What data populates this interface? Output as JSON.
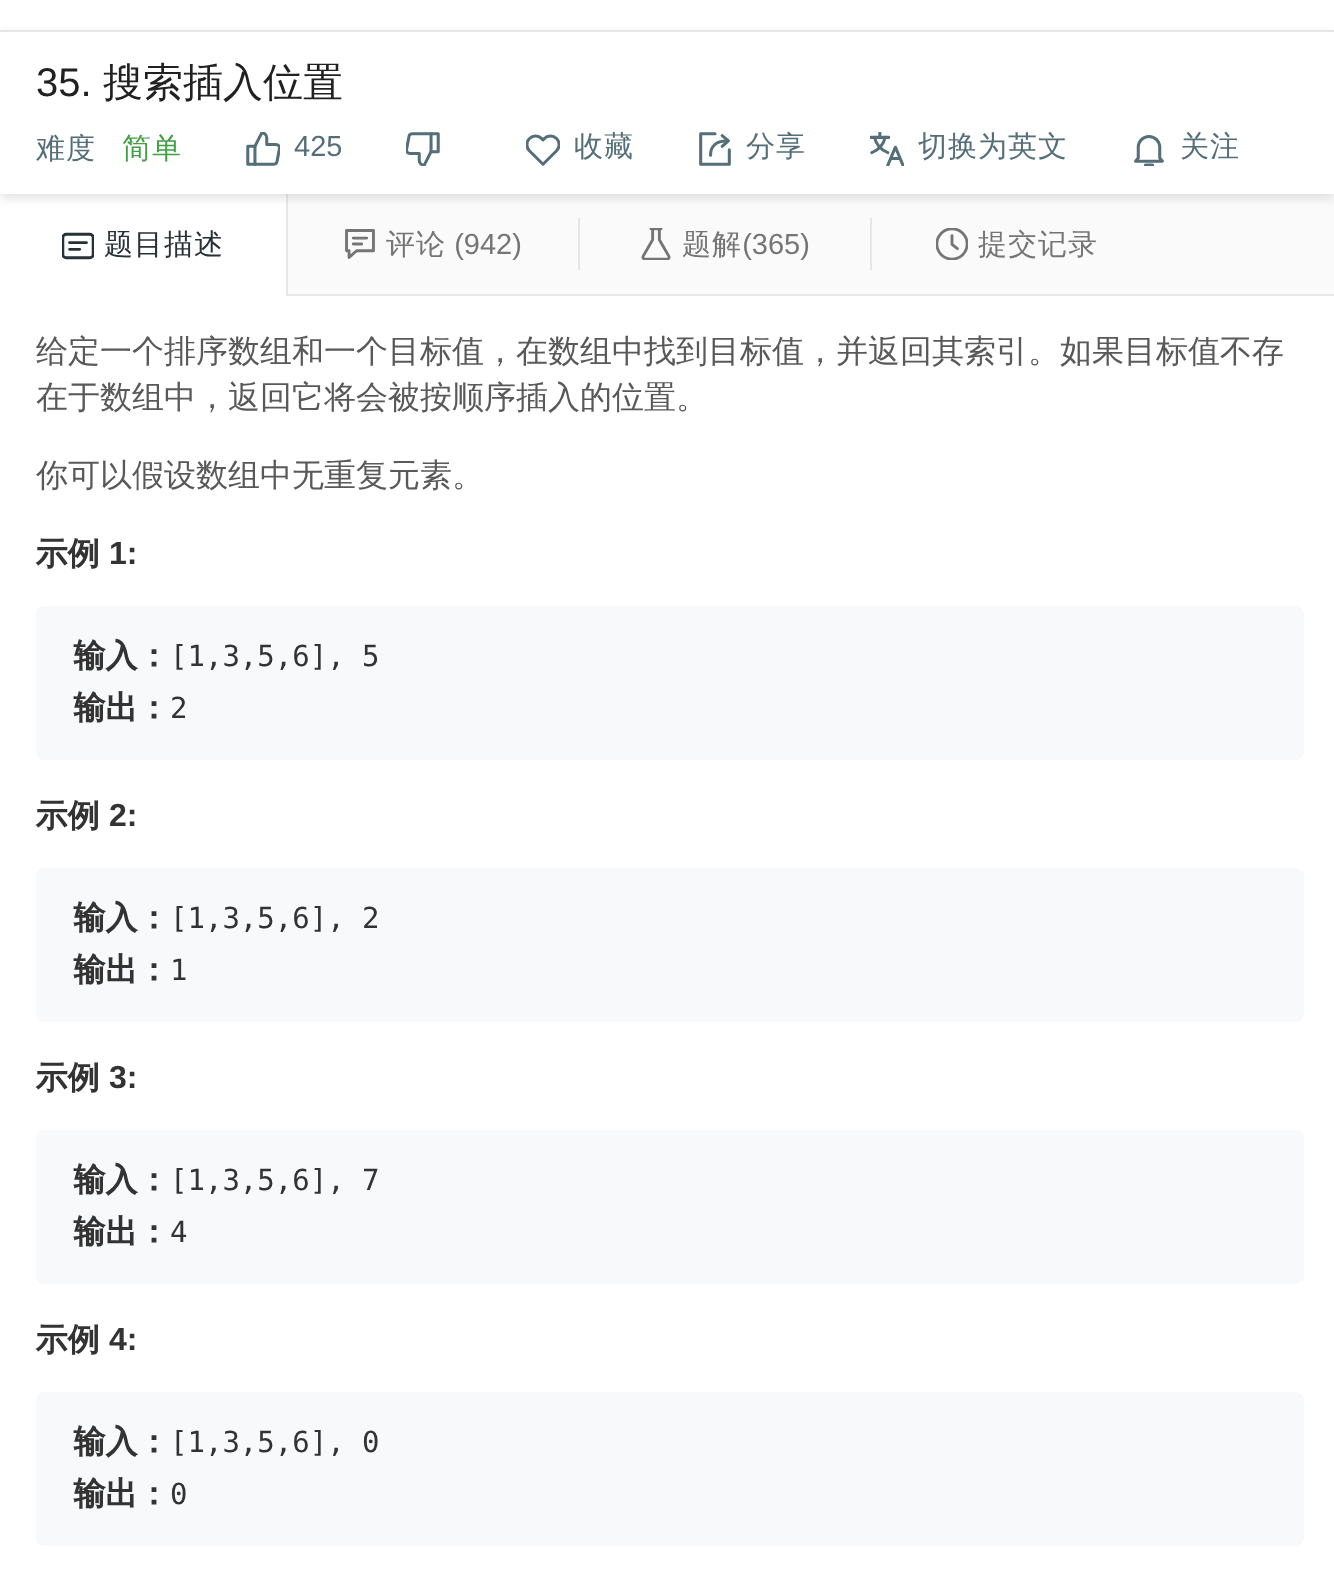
{
  "header": {
    "title": "35. 搜索插入位置",
    "difficulty_label": "难度",
    "difficulty": "简单",
    "actions": [
      {
        "kind": "like",
        "label": "425"
      },
      {
        "kind": "dislike"
      },
      {
        "kind": "favorite",
        "label": "收藏"
      },
      {
        "kind": "share",
        "label": "分享"
      },
      {
        "kind": "translate",
        "label": "切换为英文"
      },
      {
        "kind": "follow",
        "label": "关注"
      }
    ]
  },
  "tabs": [
    {
      "kind": "description",
      "label": "题目描述",
      "selected": true
    },
    {
      "kind": "comments",
      "label": "评论 (942)",
      "selected": false
    },
    {
      "kind": "solutions",
      "label": "题解(365)",
      "selected": false
    },
    {
      "kind": "submissions",
      "label": "提交记录",
      "selected": false
    }
  ],
  "description": {
    "paragraphs": [
      "给定一个排序数组和一个目标值，在数组中找到目标值，并返回其索引。如果目标值不存在于数组中，返回它将会被按顺序插入的位置。",
      "你可以假设数组中无重复元素。"
    ],
    "examples": [
      {
        "heading": "示例 1:",
        "lines": [
          "**输入：**[1,3,5,6], 5",
          "**输出：**2"
        ]
      },
      {
        "heading": "示例 2:",
        "lines": [
          "**输入：**[1,3,5,6], 2",
          "**输出：**1"
        ]
      },
      {
        "heading": "示例 3:",
        "lines": [
          "**输入：**[1,3,5,6], 7",
          "**输出：**4"
        ]
      },
      {
        "heading": "示例 4:",
        "lines": [
          "**输入：**[1,3,5,6], 0",
          "**输出：**0"
        ]
      }
    ]
  }
}
